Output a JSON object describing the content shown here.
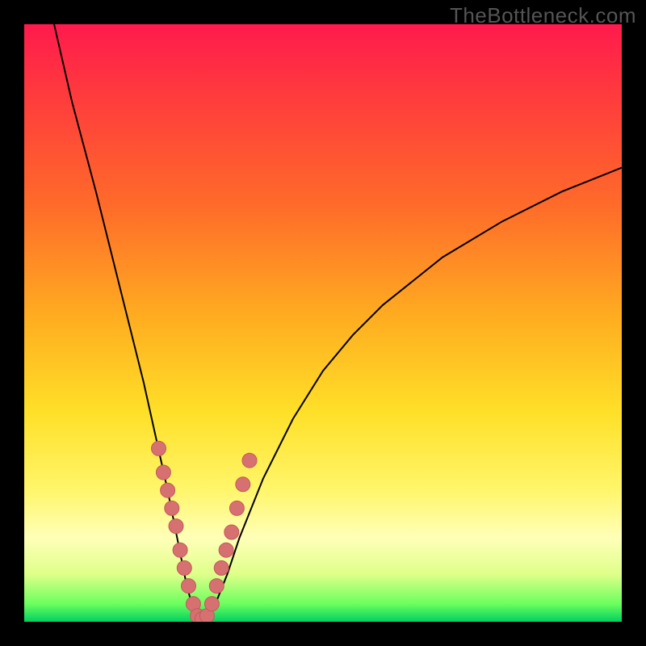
{
  "watermark": "TheBottleneck.com",
  "chart_data": {
    "type": "line",
    "title": "",
    "xlabel": "",
    "ylabel": "",
    "xlim": [
      0,
      100
    ],
    "ylim": [
      0,
      100
    ],
    "grid": false,
    "legend": false,
    "series": [
      {
        "name": "bottleneck-curve",
        "x": [
          5,
          8,
          12,
          15,
          18,
          20,
          22,
          24,
          26,
          27,
          28,
          29,
          30,
          31,
          32,
          34,
          36,
          40,
          45,
          50,
          55,
          60,
          70,
          80,
          90,
          100
        ],
        "y": [
          100,
          87,
          72,
          60,
          48,
          40,
          31,
          22,
          12,
          7,
          3,
          1,
          0,
          1,
          3,
          8,
          14,
          24,
          34,
          42,
          48,
          53,
          61,
          67,
          72,
          76
        ]
      }
    ],
    "markers": {
      "name": "highlight-points",
      "x": [
        22.5,
        23.3,
        24.0,
        24.7,
        25.4,
        26.1,
        26.8,
        27.5,
        28.3,
        29.0,
        29.8,
        30.6,
        31.4,
        32.2,
        33.0,
        33.8,
        34.7,
        35.6,
        36.6,
        37.7
      ],
      "y": [
        29,
        25,
        22,
        19,
        16,
        12,
        9,
        6,
        3,
        1,
        0.5,
        1,
        3,
        6,
        9,
        12,
        15,
        19,
        23,
        27
      ]
    },
    "background": {
      "type": "vertical-gradient",
      "stops": [
        {
          "pos": 0,
          "color": "#ff1a4d"
        },
        {
          "pos": 30,
          "color": "#ff6a2a"
        },
        {
          "pos": 65,
          "color": "#ffe028"
        },
        {
          "pos": 86,
          "color": "#ffffb8"
        },
        {
          "pos": 100,
          "color": "#00d060"
        }
      ]
    }
  }
}
